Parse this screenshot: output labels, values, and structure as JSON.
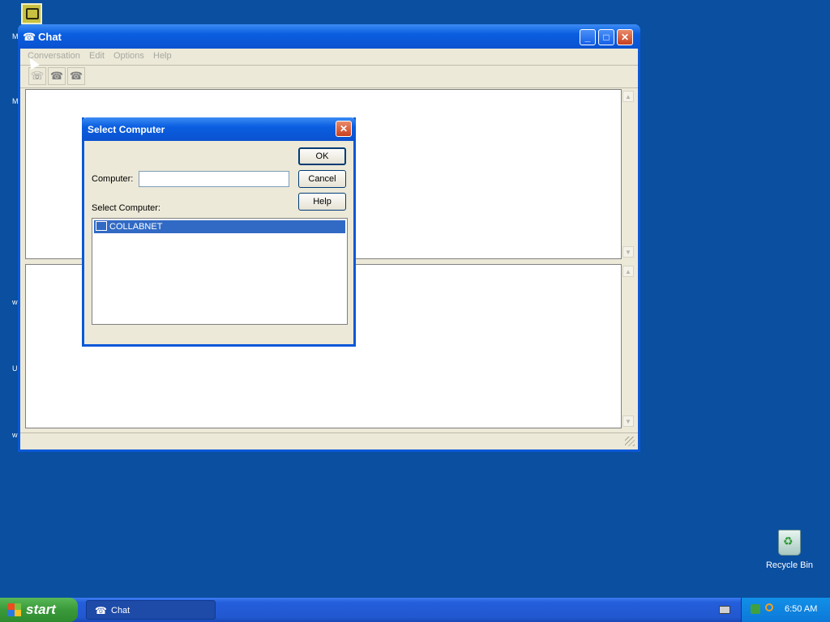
{
  "desktop": {
    "icons": [
      {
        "name": "Recycle Bin",
        "icon": "recycle-bin-icon"
      }
    ]
  },
  "chat_window": {
    "title": "Chat",
    "menu": [
      "Conversation",
      "Edit",
      "Options",
      "Help"
    ],
    "toolbar_icons": [
      "dial-icon",
      "answer-icon",
      "hang-up-icon"
    ]
  },
  "dialog": {
    "title": "Select Computer",
    "buttons": {
      "ok": "OK",
      "cancel": "Cancel",
      "help": "Help"
    },
    "computer_label": "Computer:",
    "computer_value": "",
    "select_label": "Select Computer:",
    "list_items": [
      {
        "label": "COLLABNET",
        "icon": "computer-icon",
        "selected": true
      }
    ]
  },
  "taskbar": {
    "start_label": "start",
    "tasks": [
      {
        "label": "Chat",
        "icon": "chat-icon"
      }
    ],
    "clock": "6:50 AM"
  },
  "colors": {
    "desktop": "#0a4fa0",
    "title_bar": "#0a5ee0",
    "selection": "#316ac5"
  }
}
